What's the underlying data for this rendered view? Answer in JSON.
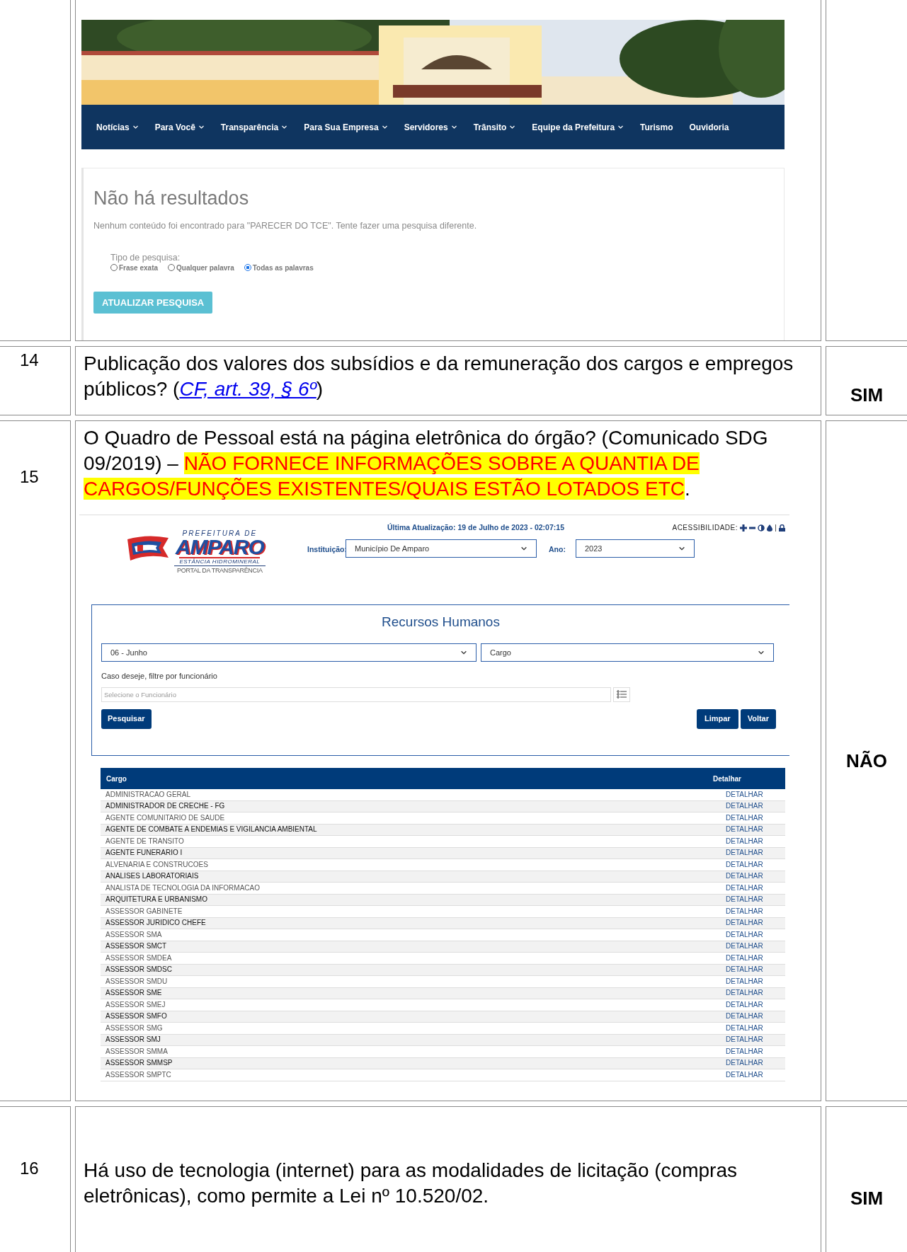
{
  "search_screenshot": {
    "nav": [
      {
        "label": "Notícias",
        "dropdown": true
      },
      {
        "label": "Para Você",
        "dropdown": true
      },
      {
        "label": "Transparência",
        "dropdown": true
      },
      {
        "label": "Para Sua Empresa",
        "dropdown": true
      },
      {
        "label": "Servidores",
        "dropdown": true
      },
      {
        "label": "Trânsito",
        "dropdown": true
      },
      {
        "label": "Equipe da Prefeitura",
        "dropdown": true
      },
      {
        "label": "Turismo",
        "dropdown": false
      },
      {
        "label": "Ouvidoria",
        "dropdown": false
      }
    ],
    "heading": "Não há resultados",
    "message": "Nenhum conteúdo foi encontrado para \"PARECER DO TCE\". Tente fazer uma pesquisa diferente.",
    "search_type_label": "Tipo de pesquisa:",
    "options": [
      {
        "label": "Frase exata",
        "selected": false
      },
      {
        "label": "Qualquer palavra",
        "selected": false
      },
      {
        "label": "Todas as palavras",
        "selected": true
      }
    ],
    "button": "ATUALIZAR PESQUISA"
  },
  "rows": [
    {
      "number": "14",
      "segments": [
        {
          "kind": "plain",
          "text": "Publicação dos valores dos subsídios e da remuneração dos cargos e empregos públicos? ("
        },
        {
          "kind": "link",
          "text": "CF, art. 39, § 6º"
        },
        {
          "kind": "plain",
          "text": ")"
        }
      ],
      "answer": "SIM"
    },
    {
      "number": "15",
      "segments": [
        {
          "kind": "plain",
          "text": "O Quadro de Pessoal está na página eletrônica do órgão? (Comunicado SDG 09/2019) – "
        },
        {
          "kind": "highlight",
          "text": "NÃO FORNECE INFORMAÇÕES SOBRE A QUANTIA DE CARGOS/FUNÇÕES EXISTENTES/QUAIS ESTÃO LOTADOS ETC"
        },
        {
          "kind": "plain",
          "text": "."
        }
      ],
      "answer": "NÃO"
    },
    {
      "number": "16",
      "segments": [
        {
          "kind": "plain",
          "text": "Há uso de tecnologia (internet) para as modalidades de licitação (compras eletrônicas), como permite a Lei nº 10.520/02."
        }
      ],
      "answer": "SIM"
    }
  ],
  "portal_screenshot": {
    "logo": {
      "top": "PREFEITURA DE",
      "name": "AMPARO",
      "sub": "ESTÂNCIA HIDROMINERAL",
      "portal": "PORTAL DA TRANSPARÊNCIA"
    },
    "last_update": "Última Atualização: 19 de Julho de 2023 - 02:07:15",
    "accessibility": "ACESSIBILIDADE:",
    "institution_label": "Instituição:",
    "institution": "Município De Amparo",
    "year_label": "Ano:",
    "year": "2023",
    "title": "Recursos Humanos",
    "month": "06 - Junho",
    "group_by": "Cargo",
    "filter_label": "Caso deseje, filtre por funcionário",
    "employee_placeholder": "Selecione o Funcionário",
    "search_button": "Pesquisar",
    "clear_button": "Limpar",
    "back_button": "Voltar",
    "table": {
      "columns": [
        "Cargo",
        "Detalhar"
      ],
      "rows": [
        {
          "cargo": "ADMINISTRACAO GERAL",
          "action": "DETALHAR"
        },
        {
          "cargo": "ADMINISTRADOR DE CRECHE - FG",
          "action": "DETALHAR"
        },
        {
          "cargo": "AGENTE COMUNITARIO DE SAUDE",
          "action": "DETALHAR"
        },
        {
          "cargo": "AGENTE DE COMBATE A ENDEMIAS E VIGILANCIA AMBIENTAL",
          "action": "DETALHAR"
        },
        {
          "cargo": "AGENTE DE TRANSITO",
          "action": "DETALHAR"
        },
        {
          "cargo": "AGENTE FUNERARIO I",
          "action": "DETALHAR"
        },
        {
          "cargo": "ALVENARIA E CONSTRUCOES",
          "action": "DETALHAR"
        },
        {
          "cargo": "ANALISES LABORATORIAIS",
          "action": "DETALHAR"
        },
        {
          "cargo": "ANALISTA DE TECNOLOGIA DA INFORMACAO",
          "action": "DETALHAR"
        },
        {
          "cargo": "ARQUITETURA E URBANISMO",
          "action": "DETALHAR"
        },
        {
          "cargo": "ASSESSOR GABINETE",
          "action": "DETALHAR"
        },
        {
          "cargo": "ASSESSOR JURIDICO CHEFE",
          "action": "DETALHAR"
        },
        {
          "cargo": "ASSESSOR SMA",
          "action": "DETALHAR"
        },
        {
          "cargo": "ASSESSOR SMCT",
          "action": "DETALHAR"
        },
        {
          "cargo": "ASSESSOR SMDEA",
          "action": "DETALHAR"
        },
        {
          "cargo": "ASSESSOR SMDSC",
          "action": "DETALHAR"
        },
        {
          "cargo": "ASSESSOR SMDU",
          "action": "DETALHAR"
        },
        {
          "cargo": "ASSESSOR SME",
          "action": "DETALHAR"
        },
        {
          "cargo": "ASSESSOR SMEJ",
          "action": "DETALHAR"
        },
        {
          "cargo": "ASSESSOR SMFO",
          "action": "DETALHAR"
        },
        {
          "cargo": "ASSESSOR SMG",
          "action": "DETALHAR"
        },
        {
          "cargo": "ASSESSOR SMJ",
          "action": "DETALHAR"
        },
        {
          "cargo": "ASSESSOR SMMA",
          "action": "DETALHAR"
        },
        {
          "cargo": "ASSESSOR SMMSP",
          "action": "DETALHAR"
        },
        {
          "cargo": "ASSESSOR SMPTC",
          "action": "DETALHAR"
        }
      ]
    }
  }
}
